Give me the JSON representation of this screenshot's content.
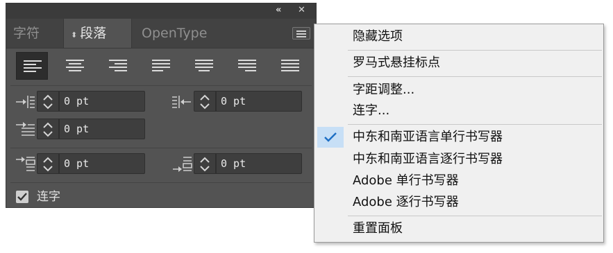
{
  "panel": {
    "titlebar": {
      "collapse_glyph": "«",
      "close_glyph": "✕"
    },
    "tabs": [
      {
        "label": "字符",
        "active": false
      },
      {
        "label": "段落",
        "active": true,
        "updown_glyph": "⬍"
      },
      {
        "label": "OpenType",
        "active": false
      }
    ],
    "alignment_buttons": [
      {
        "name": "align-left",
        "selected": true
      },
      {
        "name": "align-center",
        "selected": false
      },
      {
        "name": "align-right",
        "selected": false
      },
      {
        "name": "justify-last-left",
        "selected": false
      },
      {
        "name": "justify-last-center",
        "selected": false
      },
      {
        "name": "justify-last-right",
        "selected": false
      },
      {
        "name": "justify-all",
        "selected": false
      }
    ],
    "fields": {
      "left_indent": {
        "value": "0 pt",
        "icon": "left-indent-icon"
      },
      "right_indent": {
        "value": "0 pt",
        "icon": "right-indent-icon"
      },
      "first_line_indent": {
        "value": "0 pt",
        "icon": "first-line-indent-icon"
      },
      "space_before": {
        "value": "0 pt",
        "icon": "space-before-icon"
      },
      "space_after": {
        "value": "0 pt",
        "icon": "space-after-icon"
      }
    },
    "hyphenate": {
      "label": "连字",
      "checked": true
    }
  },
  "menu": {
    "items": [
      {
        "label": "隐藏选项"
      },
      {
        "label": "罗马式悬挂标点"
      },
      {
        "label": "字距调整..."
      },
      {
        "label": "连字..."
      },
      {
        "label": "中东和南亚语言单行书写器",
        "checked": true
      },
      {
        "label": "中东和南亚语言逐行书写器"
      },
      {
        "label": "Adobe 单行书写器"
      },
      {
        "label": "Adobe 逐行书写器"
      },
      {
        "label": "重置面板"
      }
    ]
  },
  "colors": {
    "panel_bg": "#535353",
    "field_bg": "#3e3e3e",
    "menu_bg": "#f0f0f0",
    "checked_highlight": "#c7dff6",
    "check_color": "#1e6fc4"
  }
}
